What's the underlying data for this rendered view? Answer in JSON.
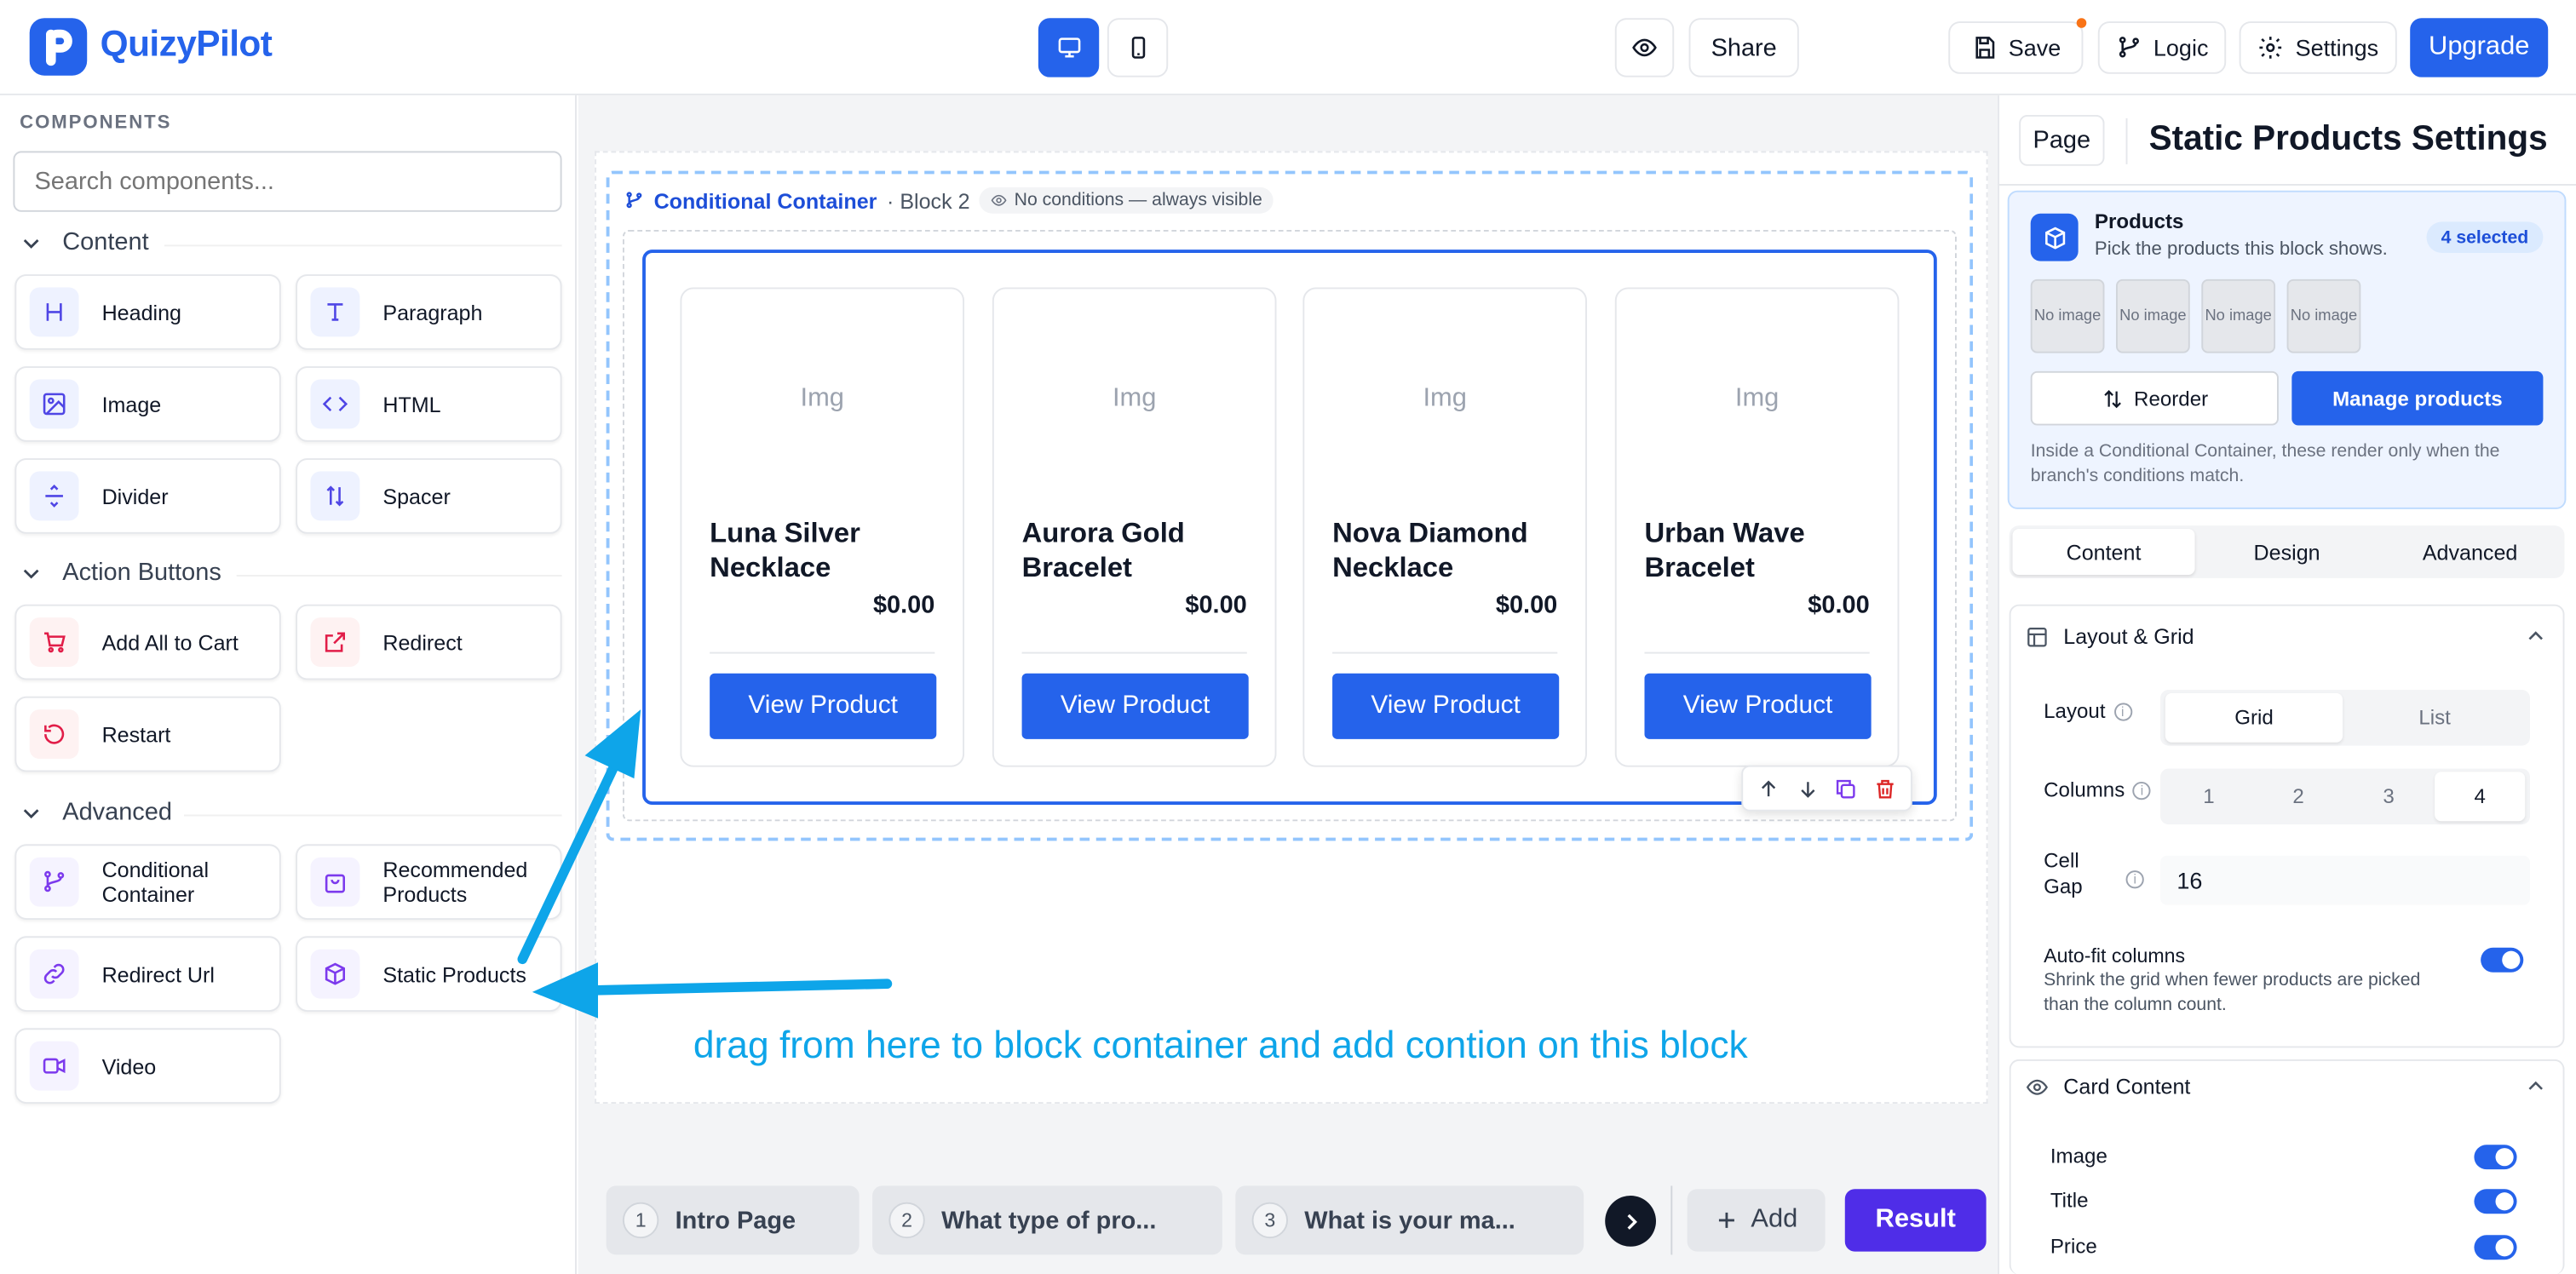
{
  "app": {
    "name": "QuizyPilot"
  },
  "topbar": {
    "share_label": "Share",
    "save_label": "Save",
    "logic_label": "Logic",
    "settings_label": "Settings",
    "upgrade_label": "Upgrade"
  },
  "components": {
    "title": "COMPONENTS",
    "search_placeholder": "Search components...",
    "sections": {
      "content": "Content",
      "action_buttons": "Action Buttons",
      "advanced": "Advanced"
    },
    "items": {
      "heading": "Heading",
      "paragraph": "Paragraph",
      "image": "Image",
      "html": "HTML",
      "divider": "Divider",
      "spacer": "Spacer",
      "add_all_to_cart": "Add All to Cart",
      "redirect": "Redirect",
      "restart": "Restart",
      "conditional_container": "Conditional Container",
      "recommended_products": "Recommended Products",
      "redirect_url": "Redirect Url",
      "static_products": "Static Products",
      "video": "Video"
    }
  },
  "canvas": {
    "container_label": "Conditional Container",
    "block_label": "· Block 2",
    "condition_pill": "No conditions — always visible",
    "products": [
      {
        "img": "Img",
        "name": "Luna Silver Necklace",
        "price": "$0.00",
        "button": "View Product"
      },
      {
        "img": "Img",
        "name": "Aurora Gold Bracelet",
        "price": "$0.00",
        "button": "View Product"
      },
      {
        "img": "Img",
        "name": "Nova Diamond Necklace",
        "price": "$0.00",
        "button": "View Product"
      },
      {
        "img": "Img",
        "name": "Urban Wave Bracelet",
        "price": "$0.00",
        "button": "View Product"
      }
    ],
    "annotation": "drag from here to block container and add contion on this block",
    "annotation_color": "#0ea5e9"
  },
  "pages_bar": {
    "pages": [
      {
        "num": "1",
        "label": "Intro Page"
      },
      {
        "num": "2",
        "label": "What type of pro..."
      },
      {
        "num": "3",
        "label": "What is your ma..."
      }
    ],
    "add_label": "Add",
    "result_label": "Result"
  },
  "settings": {
    "page_button": "Page",
    "title": "Static Products Settings",
    "products_box": {
      "title": "Products",
      "subtitle": "Pick the products this block shows.",
      "badge": "4 selected",
      "thumbs": [
        "No image",
        "No image",
        "No image",
        "No image"
      ],
      "reorder_label": "Reorder",
      "manage_label": "Manage products",
      "note": "Inside a Conditional Container, these render only when the branch's conditions match."
    },
    "tabs": [
      "Content",
      "Design",
      "Advanced"
    ],
    "active_tab": "Content",
    "layout_grid": {
      "title": "Layout & Grid",
      "layout_label": "Layout",
      "layout_options": [
        "Grid",
        "List"
      ],
      "layout_selected": "Grid",
      "columns_label": "Columns",
      "columns_options": [
        "1",
        "2",
        "3",
        "4"
      ],
      "columns_selected": "4",
      "cell_gap_label": "Cell Gap",
      "cell_gap_value": "16",
      "autofit_title": "Auto-fit columns",
      "autofit_desc": "Shrink the grid when fewer products are picked than the column count.",
      "autofit_on": true
    },
    "card_content": {
      "title": "Card Content",
      "image_label": "Image",
      "title_label": "Title",
      "price_label": "Price",
      "image_on": true,
      "title_on": true,
      "price_on": true
    }
  },
  "colors": {
    "primary": "#2563eb",
    "result": "#4f2de8",
    "arrow": "#0ea5e9"
  }
}
